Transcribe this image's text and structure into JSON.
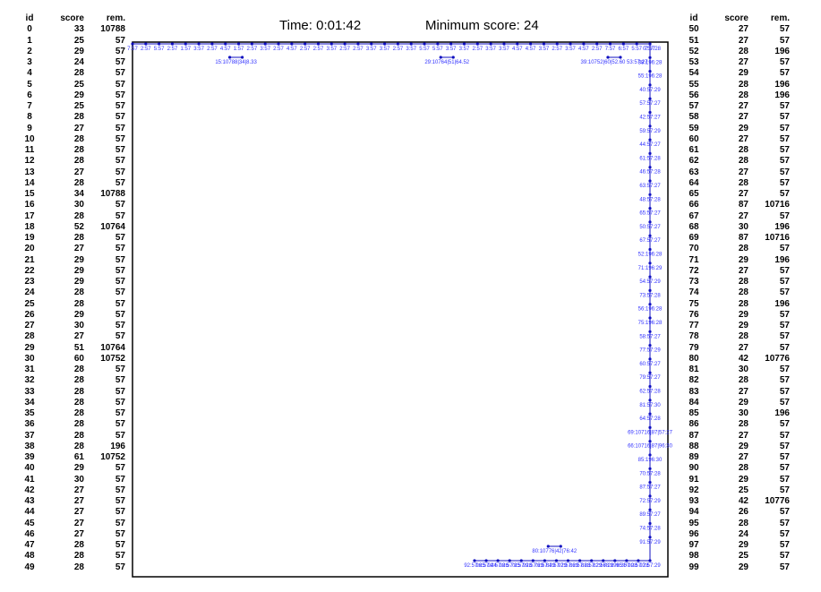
{
  "header": {
    "time_text": "Time: 0:01:42",
    "min_score_text": "Minimum score: 24"
  },
  "table_headers": {
    "id": "id",
    "score": "score",
    "rem": "rem."
  },
  "rows_left": [
    [
      "0",
      "33",
      "10788"
    ],
    [
      "1",
      "25",
      "57"
    ],
    [
      "2",
      "29",
      "57"
    ],
    [
      "3",
      "24",
      "57"
    ],
    [
      "4",
      "28",
      "57"
    ],
    [
      "5",
      "25",
      "57"
    ],
    [
      "6",
      "29",
      "57"
    ],
    [
      "7",
      "25",
      "57"
    ],
    [
      "8",
      "28",
      "57"
    ],
    [
      "9",
      "27",
      "57"
    ],
    [
      "10",
      "28",
      "57"
    ],
    [
      "11",
      "28",
      "57"
    ],
    [
      "12",
      "28",
      "57"
    ],
    [
      "13",
      "27",
      "57"
    ],
    [
      "14",
      "28",
      "57"
    ],
    [
      "15",
      "34",
      "10788"
    ],
    [
      "16",
      "30",
      "57"
    ],
    [
      "17",
      "28",
      "57"
    ],
    [
      "18",
      "52",
      "10764"
    ],
    [
      "19",
      "28",
      "57"
    ],
    [
      "20",
      "27",
      "57"
    ],
    [
      "21",
      "29",
      "57"
    ],
    [
      "22",
      "29",
      "57"
    ],
    [
      "23",
      "29",
      "57"
    ],
    [
      "24",
      "28",
      "57"
    ],
    [
      "25",
      "28",
      "57"
    ],
    [
      "26",
      "29",
      "57"
    ],
    [
      "27",
      "30",
      "57"
    ],
    [
      "28",
      "27",
      "57"
    ],
    [
      "29",
      "51",
      "10764"
    ],
    [
      "30",
      "60",
      "10752"
    ],
    [
      "31",
      "28",
      "57"
    ],
    [
      "32",
      "28",
      "57"
    ],
    [
      "33",
      "28",
      "57"
    ],
    [
      "34",
      "28",
      "57"
    ],
    [
      "35",
      "28",
      "57"
    ],
    [
      "36",
      "28",
      "57"
    ],
    [
      "37",
      "28",
      "57"
    ],
    [
      "38",
      "28",
      "196"
    ],
    [
      "39",
      "61",
      "10752"
    ],
    [
      "40",
      "29",
      "57"
    ],
    [
      "41",
      "30",
      "57"
    ],
    [
      "42",
      "27",
      "57"
    ],
    [
      "43",
      "27",
      "57"
    ],
    [
      "44",
      "27",
      "57"
    ],
    [
      "45",
      "27",
      "57"
    ],
    [
      "46",
      "27",
      "57"
    ],
    [
      "47",
      "28",
      "57"
    ],
    [
      "48",
      "28",
      "57"
    ],
    [
      "49",
      "28",
      "57"
    ]
  ],
  "rows_right": [
    [
      "50",
      "27",
      "57"
    ],
    [
      "51",
      "27",
      "57"
    ],
    [
      "52",
      "28",
      "196"
    ],
    [
      "53",
      "27",
      "57"
    ],
    [
      "54",
      "29",
      "57"
    ],
    [
      "55",
      "28",
      "196"
    ],
    [
      "56",
      "28",
      "196"
    ],
    [
      "57",
      "27",
      "57"
    ],
    [
      "58",
      "27",
      "57"
    ],
    [
      "59",
      "29",
      "57"
    ],
    [
      "60",
      "27",
      "57"
    ],
    [
      "61",
      "28",
      "57"
    ],
    [
      "62",
      "28",
      "57"
    ],
    [
      "63",
      "27",
      "57"
    ],
    [
      "64",
      "28",
      "57"
    ],
    [
      "65",
      "27",
      "57"
    ],
    [
      "66",
      "87",
      "10716"
    ],
    [
      "67",
      "27",
      "57"
    ],
    [
      "68",
      "30",
      "196"
    ],
    [
      "69",
      "87",
      "10716"
    ],
    [
      "70",
      "28",
      "57"
    ],
    [
      "71",
      "29",
      "196"
    ],
    [
      "72",
      "27",
      "57"
    ],
    [
      "73",
      "28",
      "57"
    ],
    [
      "74",
      "28",
      "57"
    ],
    [
      "75",
      "28",
      "196"
    ],
    [
      "76",
      "29",
      "57"
    ],
    [
      "77",
      "29",
      "57"
    ],
    [
      "78",
      "28",
      "57"
    ],
    [
      "79",
      "27",
      "57"
    ],
    [
      "80",
      "42",
      "10776"
    ],
    [
      "81",
      "30",
      "57"
    ],
    [
      "82",
      "28",
      "57"
    ],
    [
      "83",
      "27",
      "57"
    ],
    [
      "84",
      "29",
      "57"
    ],
    [
      "85",
      "30",
      "196"
    ],
    [
      "86",
      "28",
      "57"
    ],
    [
      "87",
      "27",
      "57"
    ],
    [
      "88",
      "29",
      "57"
    ],
    [
      "89",
      "27",
      "57"
    ],
    [
      "90",
      "28",
      "57"
    ],
    [
      "91",
      "29",
      "57"
    ],
    [
      "92",
      "25",
      "57"
    ],
    [
      "93",
      "42",
      "10776"
    ],
    [
      "94",
      "26",
      "57"
    ],
    [
      "95",
      "28",
      "57"
    ],
    [
      "96",
      "24",
      "57"
    ],
    [
      "97",
      "29",
      "57"
    ],
    [
      "98",
      "25",
      "57"
    ],
    [
      "99",
      "29",
      "57"
    ]
  ],
  "chart_data": {
    "type": "scatter",
    "title": "",
    "xlabel": "",
    "ylabel": "",
    "series_color": "#1010c0",
    "label_color": "#3333ff",
    "top_path": {
      "y": 0,
      "points": [
        {
          "x": 0,
          "label": "7:57"
        },
        {
          "x": 1,
          "label": "2:57"
        },
        {
          "x": 2,
          "label": "5:57"
        },
        {
          "x": 3,
          "label": "2:57"
        },
        {
          "x": 4,
          "label": "1:57"
        },
        {
          "x": 5,
          "label": "3:57"
        },
        {
          "x": 6,
          "label": "2:57"
        },
        {
          "x": 7,
          "label": "4:57"
        },
        {
          "x": 8,
          "label": "1:57"
        },
        {
          "x": 9,
          "label": "2:57"
        },
        {
          "x": 10,
          "label": "3:57"
        },
        {
          "x": 11,
          "label": "2:57"
        },
        {
          "x": 12,
          "label": "4:57"
        },
        {
          "x": 13,
          "label": "2:57"
        },
        {
          "x": 14,
          "label": "2:57"
        },
        {
          "x": 15,
          "label": "3:57"
        },
        {
          "x": 16,
          "label": "2:57"
        },
        {
          "x": 17,
          "label": "2:57"
        },
        {
          "x": 18,
          "label": "3:57"
        },
        {
          "x": 19,
          "label": "3:57"
        },
        {
          "x": 20,
          "label": "2:57"
        },
        {
          "x": 21,
          "label": "3:57"
        },
        {
          "x": 22,
          "label": "5:57"
        },
        {
          "x": 23,
          "label": "5:57"
        },
        {
          "x": 24,
          "label": "3:57"
        },
        {
          "x": 25,
          "label": "3:57"
        },
        {
          "x": 26,
          "label": "2:57"
        },
        {
          "x": 27,
          "label": "3:57"
        },
        {
          "x": 28,
          "label": "3:57"
        },
        {
          "x": 29,
          "label": "4:57"
        },
        {
          "x": 30,
          "label": "4:57"
        },
        {
          "x": 31,
          "label": "3:57"
        },
        {
          "x": 32,
          "label": "2:57"
        },
        {
          "x": 33,
          "label": "3:57"
        },
        {
          "x": 34,
          "label": "4:57"
        },
        {
          "x": 35,
          "label": "2:57"
        },
        {
          "x": 36,
          "label": "7:57"
        },
        {
          "x": 37,
          "label": "6:57"
        },
        {
          "x": 38,
          "label": "5:57"
        },
        {
          "x": 39,
          "label": "7:57"
        }
      ],
      "end_label": "0:57:28"
    },
    "clusters": [
      {
        "x": 7.8,
        "y": 1,
        "label": "15:10788|34|8.33"
      },
      {
        "x": 23.7,
        "y": 1,
        "label": "29:10764|51|64.52"
      },
      {
        "x": 36.3,
        "y": 1,
        "label": "39:10752|60|52.60 53:57:27"
      }
    ],
    "right_column": {
      "x": 39,
      "labels": [
        "38:196:28",
        "55:196:28",
        "40:57:29",
        "57:57:27",
        "42:57:27",
        "59:57:29",
        "44:57:27",
        "61:57:28",
        "46:57:28",
        "63:57:27",
        "48:57:28",
        "65:57:27",
        "50:57:27",
        "67:57:27",
        "52:196:28",
        "71:196:29",
        "54:57:29",
        "73:57:28",
        "56:196:28",
        "75:196:28",
        "58:57:27",
        "77:57:29",
        "60:57:27",
        "79:57:27",
        "62:57:28",
        "81:57:30",
        "64:57:28",
        "69:10716|87|57:27",
        "66:10716|87|96:30",
        "85:196:30",
        "70:57:28",
        "87:57:27",
        "72:57:29",
        "89:57:27",
        "74:57:28",
        "91:57:29"
      ]
    },
    "bottom_cluster": {
      "x": 31.8,
      "label": "80:10776|42|76:42"
    },
    "bottom_path": {
      "labels": [
        "92:57:25",
        "96:57:24",
        "94:57:26",
        "98:57:25",
        "78:57:28",
        "99:57:29",
        "76:57:29",
        "84:57:29",
        "97:57:29",
        "86:57:28",
        "88:57:29",
        "82:57:28",
        "68:196:30",
        "95:57:28",
        "90:57:28",
        "97:57:29"
      ]
    }
  }
}
